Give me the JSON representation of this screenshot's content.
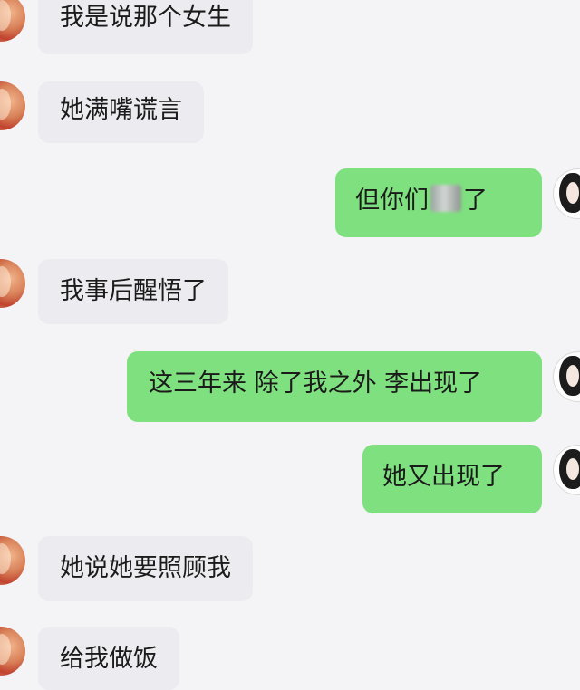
{
  "messages": [
    {
      "side": "left",
      "text": "我是说那个女生"
    },
    {
      "side": "left",
      "text": "她满嘴谎言"
    },
    {
      "side": "right",
      "text_before": "但你们",
      "text_after": "了"
    },
    {
      "side": "left",
      "text": "我事后醒悟了"
    },
    {
      "side": "right",
      "text": "这三年来 除了我之外 李出现了"
    },
    {
      "side": "right",
      "text": "她又出现了"
    },
    {
      "side": "left",
      "text": "她说她要照顾我"
    },
    {
      "side": "left",
      "text": "给我做饭"
    }
  ]
}
